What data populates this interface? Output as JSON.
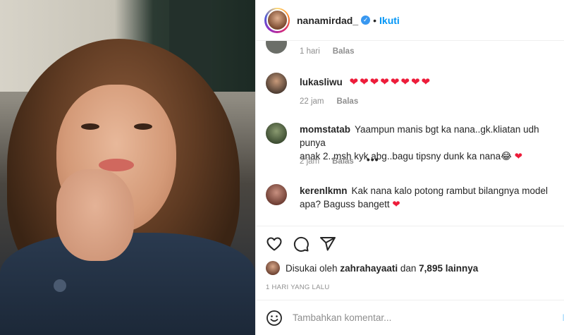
{
  "header": {
    "username": "nanamirdad_",
    "verified_icon": "verified-badge-icon",
    "separator": "•",
    "follow_label": "Ikuti"
  },
  "comments": [
    {
      "username": "",
      "text": "",
      "meta": {
        "time": "1 hari",
        "reply": "Balas"
      }
    },
    {
      "username": "lukasliwu",
      "text": "❤❤❤❤❤❤❤❤",
      "meta": {
        "time": "22 jam",
        "reply": "Balas"
      }
    },
    {
      "username": "momstatab",
      "text_line1": "Yaampun manis bgt ka nana..gk.kliatan udh punya",
      "text_line2": "anak 2..msh kyk abg..bagu tipsny dunk ka nana😂",
      "heart": "❤",
      "meta": {
        "time": "2 jam",
        "reply": "Balas",
        "more": "•••"
      }
    },
    {
      "username": "kerenlkmn",
      "text_line1": "Kak nana kalo potong rambut bilangnya model",
      "text_line2": "apa? Baguss bangett",
      "heart": "❤"
    }
  ],
  "likes": {
    "prefix": "Disukai oleh",
    "user": "zahrahayaati",
    "middle": "dan",
    "count": "7,895 lainnya"
  },
  "date": "1 HARI YANG LALU",
  "add_comment": {
    "placeholder": "Tambahkan komentar...",
    "post_label": "Ki"
  },
  "colors": {
    "accent": "#0095f6",
    "heart": "#ed1c3a",
    "muted": "#8e8e8e"
  }
}
